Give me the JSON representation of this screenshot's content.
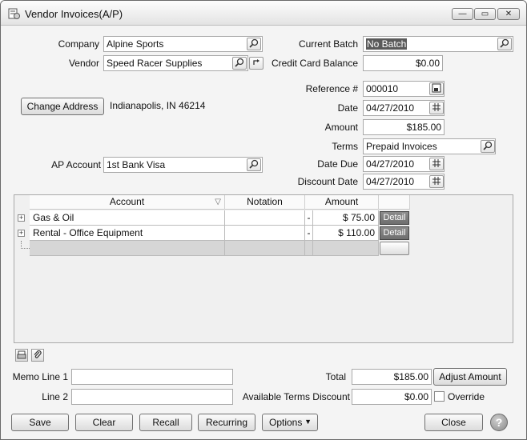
{
  "window": {
    "title": "Vendor Invoices(A/P)",
    "minimize_glyph": "—",
    "maximize_glyph": "▭",
    "close_glyph": "✕"
  },
  "form": {
    "company_label": "Company",
    "company_value": "Alpine Sports",
    "vendor_label": "Vendor",
    "vendor_value": "Speed Racer Supplies",
    "change_address_label": "Change Address",
    "address_text": "Indianapolis, IN  46214",
    "ap_account_label": "AP Account",
    "ap_account_value": "1st Bank Visa",
    "current_batch_label": "Current Batch",
    "current_batch_value": "No Batch",
    "credit_card_balance_label": "Credit Card Balance",
    "credit_card_balance_value": "$0.00",
    "reference_label": "Reference #",
    "reference_value": "000010",
    "date_label": "Date",
    "date_value": "04/27/2010",
    "amount_label": "Amount",
    "amount_value": "$185.00",
    "terms_label": "Terms",
    "terms_value": "Prepaid Invoices",
    "date_due_label": "Date Due",
    "date_due_value": "04/27/2010",
    "discount_date_label": "Discount Date",
    "discount_date_value": "04/27/2010"
  },
  "grid": {
    "columns": [
      "Account",
      "Notation",
      "Amount"
    ],
    "sort_glyph": "▽",
    "rows": [
      {
        "expander": "+",
        "account": "Gas & Oil",
        "notation": "",
        "sign": "-",
        "amount": "$ 75.00",
        "detail": "Detail"
      },
      {
        "expander": "+",
        "account": "Rental - Office Equipment",
        "notation": "",
        "sign": "-",
        "amount": "$ 110.00",
        "detail": "Detail"
      }
    ]
  },
  "footer": {
    "memo_line1_label": "Memo Line 1",
    "memo_line1_value": "",
    "line2_label": "Line 2",
    "line2_value": "",
    "total_label": "Total",
    "total_value": "$185.00",
    "adjust_amount_label": "Adjust Amount",
    "available_terms_discount_label": "Available Terms Discount",
    "available_terms_discount_value": "$0.00",
    "override_label": "Override",
    "override_checked": false
  },
  "buttons": {
    "save": "Save",
    "clear": "Clear",
    "recall": "Recall",
    "recurring": "Recurring",
    "options": "Options",
    "close": "Close",
    "help": "?"
  },
  "icons": {
    "title_icon": "invoice-icon",
    "lookup_icon": "magnifier-icon",
    "calendar_icon": "calendar-icon",
    "chevron_down": "▼"
  }
}
